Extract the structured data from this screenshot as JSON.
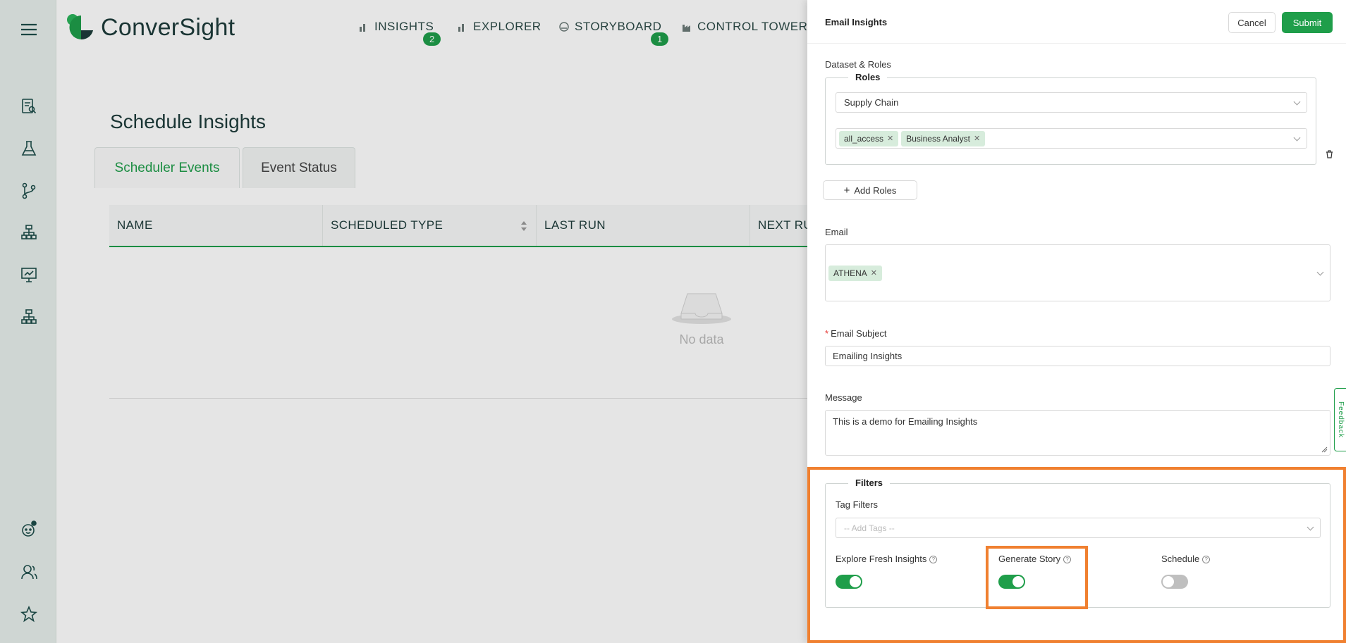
{
  "app": {
    "logo_text": "ConverSight"
  },
  "nav": [
    {
      "label": "INSIGHTS",
      "badge": "2"
    },
    {
      "label": "EXPLORER",
      "badge": ""
    },
    {
      "label": "STORYBOARD",
      "badge": "1"
    },
    {
      "label": "CONTROL TOWER",
      "badge": ""
    }
  ],
  "page": {
    "title": "Schedule Insights",
    "tabs": [
      "Scheduler Events",
      "Event Status"
    ],
    "columns": [
      "NAME",
      "SCHEDULED TYPE",
      "LAST RUN",
      "NEXT RU"
    ],
    "empty_text": "No data"
  },
  "panel": {
    "title": "Email Insights",
    "cancel": "Cancel",
    "submit": "Submit",
    "dataset_label": "Dataset & Roles",
    "roles_legend": "Roles",
    "dataset_value": "Supply Chain",
    "role_tags": [
      "all_access",
      "Business Analyst"
    ],
    "add_roles": "Add Roles",
    "email_label": "Email",
    "email_tags": [
      "ATHENA"
    ],
    "subject_label": "Email Subject",
    "subject_required": "*",
    "subject_value": "Emailing Insights",
    "message_label": "Message",
    "message_value": "This is a demo for Emailing Insights",
    "filters_legend": "Filters",
    "tag_filters_label": "Tag Filters",
    "tag_filters_placeholder": "-- Add Tags --",
    "toggles": [
      {
        "label": "Explore Fresh Insights",
        "on": true
      },
      {
        "label": "Generate Story",
        "on": true
      },
      {
        "label": "Schedule",
        "on": false
      }
    ],
    "help_glyph": "?"
  },
  "feedback": "Feedback",
  "colors": {
    "accent": "#1f9e4a",
    "highlight": "#f08030",
    "sidebar_bg": "#e7efeb"
  }
}
